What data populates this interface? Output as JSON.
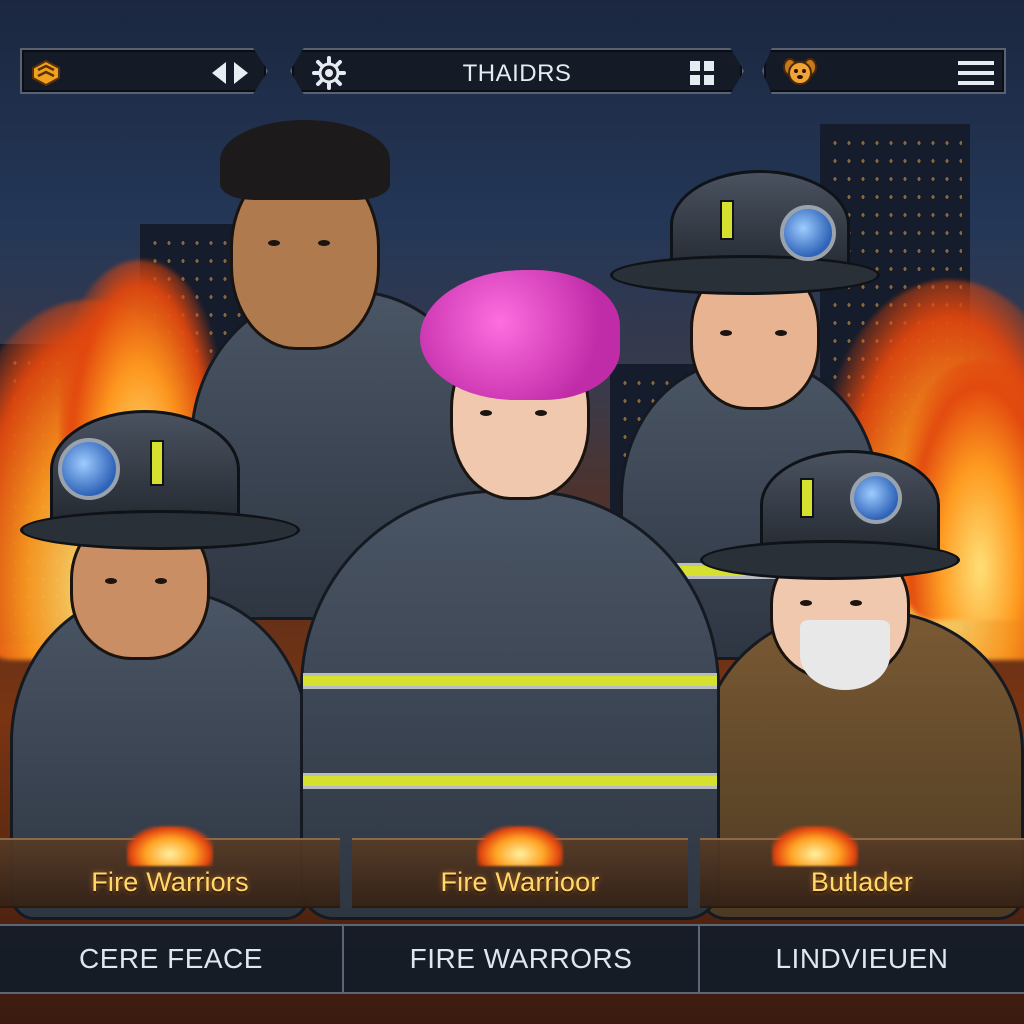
{
  "top_bar": {
    "left": {
      "logo_icon": "fire-badge-icon",
      "nav_icon": "prev-next-arrows-icon"
    },
    "center": {
      "title": "THAIDRS",
      "settings_icon": "gear-icon",
      "grid_icon": "grid-icon"
    },
    "right": {
      "pet_icon": "dog-mascot-icon",
      "menu_icon": "hamburger-menu-icon"
    }
  },
  "name_plates": [
    {
      "label": "Fire Warriors"
    },
    {
      "label": "Fire Warrioor"
    },
    {
      "label": "Butlader"
    }
  ],
  "bottom_tabs": [
    {
      "label": "CERE FEACE"
    },
    {
      "label": "FIRE WARRORS"
    },
    {
      "label": "LINDVIEUEN"
    }
  ],
  "colors": {
    "accent_gold": "#ffd86a",
    "hud_bg": "#141a24",
    "reflective_stripe": "#d6e02e",
    "fire_orange": "#ff9a1f"
  }
}
